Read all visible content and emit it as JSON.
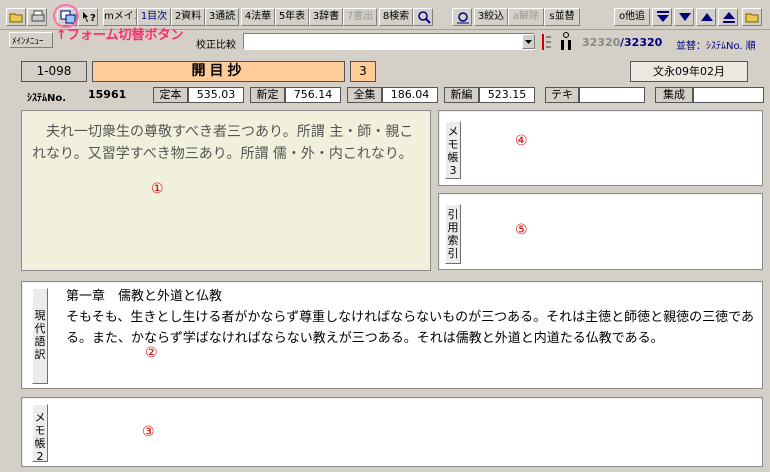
{
  "toolbar": {
    "btn_main": "mメイン",
    "btn_toc": "1目次",
    "btn_material": "2資料",
    "btn_continuous": "3通読",
    "btn_hokke": "4法華",
    "btn_chronology": "5年表",
    "btn_dictionary": "3辞書",
    "btn_write": "7書出",
    "btn_search": "8検索",
    "btn_narrow": "3絞込",
    "btn_delete": "a解除",
    "btn_sort": "s並替",
    "btn_other": "o他追",
    "annotation": "↑フォーム切替ボタン"
  },
  "row2": {
    "menu_label": "ﾒｲﾝﾒﾆｭｰ",
    "compare_label": "校正比較",
    "record_pos": "32320",
    "record_total": "/32320",
    "sort_label": "並替：ｼｽﾃﾑNo. 順"
  },
  "header": {
    "code": "1-098",
    "title": "開目抄",
    "volume": "3",
    "date": "文永09年02月"
  },
  "info": {
    "system_no_label": "ｼｽﾃﾑNo.",
    "system_no": "15961",
    "teihon_label": "定本",
    "teihon": "535.03",
    "shintei_label": "新定",
    "shintei": "756.14",
    "zenshu_label": "全集",
    "zenshu": "186.04",
    "shinpen_label": "新編",
    "shinpen": "523.15",
    "text_label": "テキ",
    "text_value": "",
    "shusei_label": "集成",
    "shusei": ""
  },
  "panels": {
    "original_text": "夫れ一切衆生の尊敬すべき者三つあり。所謂 主・師・親これなり。又習学すべき物三あり。所謂 儒・外・内これなり。",
    "marker1": "①",
    "memo3_label": "メモ帳3",
    "marker4": "④",
    "citation_label": "引用索引",
    "marker5": "⑤",
    "modern_label": "現代語訳",
    "modern_heading": "第一章　儒教と外道と仏教",
    "modern_text": "そもそも、生きとし生ける者がかならず尊重しなければならないものが三つある。それは主徳と師徳と親徳の三徳である。また、かならず学ばなければならない教えが三つある。それは儒教と外道と内道たる仏教である。",
    "marker2": "②",
    "memo2_label": "メモ帳2",
    "marker3": "③"
  },
  "colors": {
    "title_bg": "#ffcc99",
    "original_bg": "#f0f0dc",
    "annotation": "#ff2a6d",
    "marker": "#e00000"
  }
}
